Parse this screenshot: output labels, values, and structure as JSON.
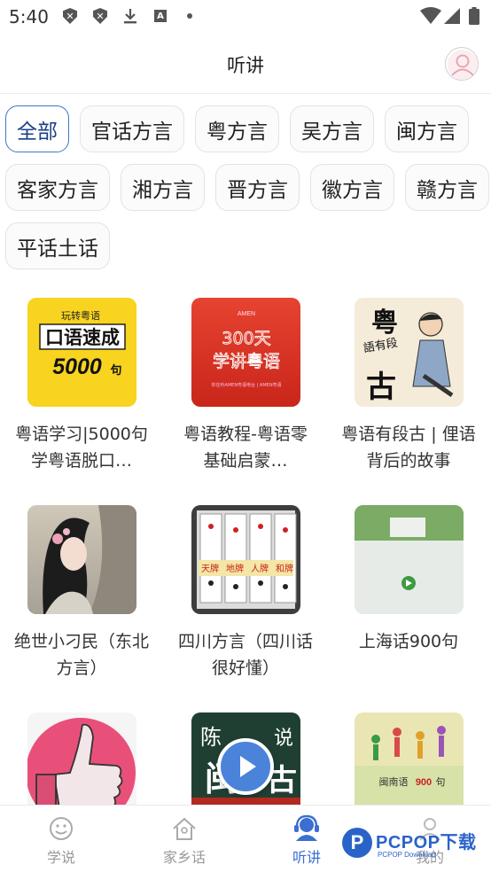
{
  "status_bar": {
    "time": "5:40",
    "icons": [
      "shield-x-icon",
      "shield-x-icon",
      "download-icon",
      "a-badge-icon",
      "dot-icon",
      "wifi-icon",
      "signal-icon",
      "battery-icon"
    ]
  },
  "header": {
    "title": "听讲",
    "avatar_icon": "user-icon"
  },
  "categories": [
    "全部",
    "官话方言",
    "粤方言",
    "吴方言",
    "闽方言",
    "客家方言",
    "湘方言",
    "晋方言",
    "徽方言",
    "赣方言",
    "平话土话"
  ],
  "selected_category": "全部",
  "thumb_texts": {
    "yellow_top": "玩转粤语",
    "yellow_mid": "口语速成",
    "yellow_big": "5000",
    "yellow_small": "句",
    "red_top": "AMEN",
    "red_big1": "300天",
    "red_big2": "学讲粤语",
    "red_bottom": "你在听AMEN粤语电台 | AMEN粤语",
    "cream_big1": "粤",
    "cream_mid": "語有段",
    "cream_big2": "古",
    "tile1": "天牌",
    "tile2": "地牌",
    "tile3": "人牌",
    "tile4": "和牌",
    "green_top": "陈",
    "green_big": "闽",
    "green_mid": "说",
    "green_right": "古",
    "fest_text": "闽南语",
    "fest_num": "900",
    "fest_tail": "句"
  },
  "items": [
    {
      "title": "粤语学习|5000句学粤语脱口…",
      "thumb": "yellow"
    },
    {
      "title": "粤语教程-粤语零基础启蒙…",
      "thumb": "red"
    },
    {
      "title": "粤语有段古 | 俚语背后的故事",
      "thumb": "cream"
    },
    {
      "title": "绝世小刁民（东北方言）",
      "thumb": "wolf"
    },
    {
      "title": "四川方言（四川话很好懂）",
      "thumb": "cards"
    },
    {
      "title": "上海话900句",
      "thumb": "shanghai"
    },
    {
      "title": "",
      "thumb": "thumbsup"
    },
    {
      "title": "",
      "thumb": "green"
    },
    {
      "title": "",
      "thumb": "fest"
    }
  ],
  "bottom_nav": [
    {
      "label": "学说",
      "icon": "smile-icon",
      "active": false
    },
    {
      "label": "家乡话",
      "icon": "home-icon",
      "active": false
    },
    {
      "label": "听讲",
      "icon": "headset-icon",
      "active": true
    },
    {
      "label": "我的",
      "icon": "person-icon",
      "active": false
    }
  ],
  "watermark": {
    "brand": "PCPOP下载",
    "sub": "PCPOP Download"
  },
  "colors": {
    "accent": "#3b6fd1",
    "chip_active_border": "#3f77c4",
    "text": "#222222",
    "muted": "#999999"
  }
}
